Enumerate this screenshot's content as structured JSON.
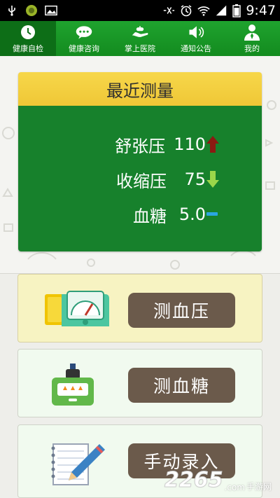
{
  "status_bar": {
    "time": "9:47",
    "icons": [
      "usb-icon",
      "app-icon",
      "image-icon",
      "mute-icon",
      "alarm-icon",
      "wifi-icon",
      "signal-icon",
      "battery-icon"
    ]
  },
  "nav": {
    "items": [
      {
        "label": "健康自检",
        "icon": "clock-icon",
        "active": true
      },
      {
        "label": "健康咨询",
        "icon": "chat-bubble-icon",
        "active": false
      },
      {
        "label": "掌上医院",
        "icon": "hand-pill-icon",
        "active": false
      },
      {
        "label": "通知公告",
        "icon": "speaker-icon",
        "active": false
      },
      {
        "label": "我的",
        "icon": "person-icon",
        "active": false
      }
    ]
  },
  "recent": {
    "title": "最近测量",
    "rows": [
      {
        "label": "舒张压",
        "value": "110",
        "trend": "up",
        "trend_color": "#8b1a12"
      },
      {
        "label": "收缩压",
        "value": "75",
        "trend": "down",
        "trend_color": "#9bd64a"
      },
      {
        "label": "血糖",
        "value": "5.0",
        "trend": "flat",
        "trend_color": "#2aa6e0"
      }
    ]
  },
  "actions": [
    {
      "label": "测血压",
      "icon": "blood-pressure-monitor-icon"
    },
    {
      "label": "测血糖",
      "icon": "glucose-meter-icon"
    },
    {
      "label": "手动录入",
      "icon": "notepad-pencil-icon"
    }
  ],
  "watermark": {
    "logo": "2265",
    "suffix": ".com",
    "text": "手游网"
  },
  "colors": {
    "nav_green": "#1a9a28",
    "card_green": "#17812c",
    "header_yellow": "#f3d03f",
    "button_brown": "#6b5a4b"
  }
}
